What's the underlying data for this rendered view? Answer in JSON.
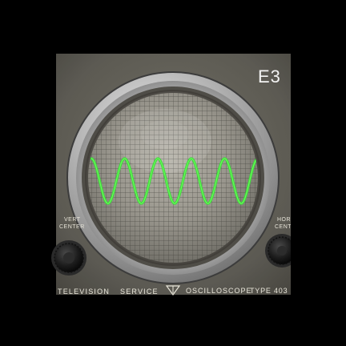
{
  "panel": {
    "corner_label": "E3",
    "left_knob_label": "VERT CENTER",
    "left_knob_label_top": "VERT",
    "left_knob_label_bottom": "CENTER",
    "right_knob_label_top": "HOR",
    "right_knob_label_bottom": "CENT",
    "bottom_text_left": "TELEVISION SERVICE",
    "bottom_text_left_a": "TELEVISION",
    "bottom_text_left_b": "SERVICE",
    "bottom_text_right": "OSCILLOSCOPE TYPE 403",
    "bottom_text_right_a": "OSCILLOSCOPE",
    "bottom_text_right_b": "TYPE 403"
  },
  "screen": {
    "trace_cycles": 5,
    "trace_color": "#3ddc3a",
    "graticule": "fine-grid"
  },
  "colors": {
    "background": "#000000",
    "panel": "#5e5c53",
    "bezel": "#bdbdbd",
    "tube_glass": "#9a9890",
    "trace": "#3ddc3a"
  }
}
